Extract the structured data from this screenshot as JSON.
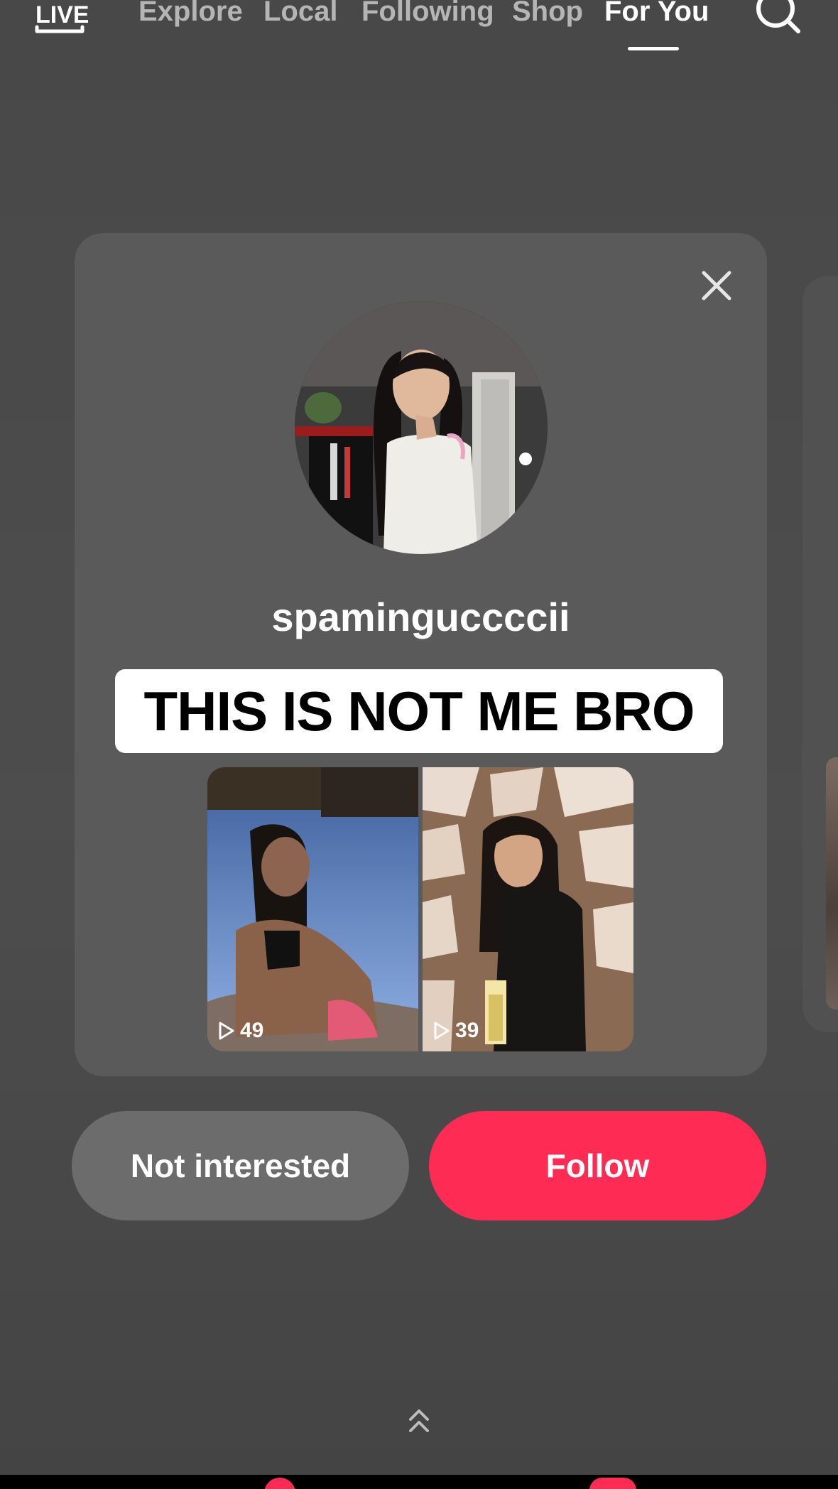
{
  "top_nav": {
    "live_label": "LIVE",
    "tabs": [
      {
        "label": "Explore",
        "active": false
      },
      {
        "label": "Local",
        "active": false
      },
      {
        "label": "Following",
        "active": false
      },
      {
        "label": "Shop",
        "active": false
      },
      {
        "label": "For You",
        "active": true
      }
    ],
    "search_icon": "search-icon"
  },
  "suggestion_card": {
    "close_icon": "close-icon",
    "username": "spaminguccccii",
    "caption": "THIS IS NOT ME BRO",
    "videos": [
      {
        "play_icon": "play-icon",
        "views": "49"
      },
      {
        "play_icon": "play-icon",
        "views": "39"
      }
    ]
  },
  "actions": {
    "not_interested_label": "Not interested",
    "follow_label": "Follow"
  },
  "footer": {
    "swipe_icon": "double-chevron-up-icon"
  },
  "colors": {
    "background": "#4a4a4a",
    "card": "#5a5a5a",
    "follow_accent": "#fe2c55",
    "secondary_button": "#6c6c6c",
    "caption_bg": "#ffffff"
  }
}
